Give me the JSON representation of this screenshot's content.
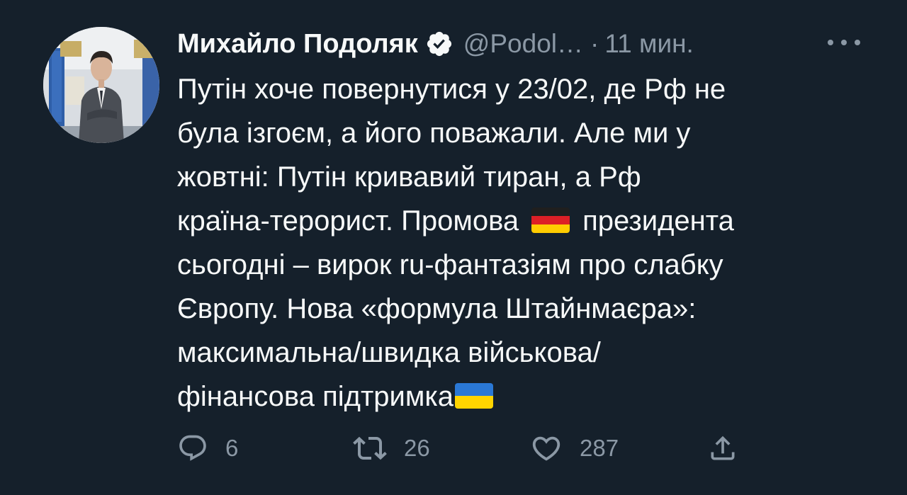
{
  "tweet": {
    "author_name": "Михайло Подоляк",
    "handle": "@Podol…",
    "separator": "·",
    "time": "11 мин.",
    "text_lines": [
      "Путін хоче повернутися у 23/02, де Рф не",
      "була ізгоєм, а його поважали. Але ми у",
      "жовтні: Путін кривавий тиран, а Рф",
      "країна-терорист. Промова",
      "президента",
      "сьогодні – вирок ru-фантазіям про слабку",
      "Європу. Нова «формула Штайнмаєра»:",
      "максимальна/швидка військова/",
      "фінансова підтримка"
    ],
    "flags": [
      "germany-flag-emoji",
      "ukraine-flag-emoji"
    ]
  },
  "actions": {
    "reply_count": "6",
    "retweet_count": "26",
    "like_count": "287"
  },
  "icons": [
    "verified-badge-icon",
    "more-icon",
    "reply-icon",
    "retweet-icon",
    "like-icon",
    "share-icon"
  ],
  "colors": {
    "background": "#15202b",
    "text": "#f7f9f9",
    "secondary": "#8b98a5"
  }
}
